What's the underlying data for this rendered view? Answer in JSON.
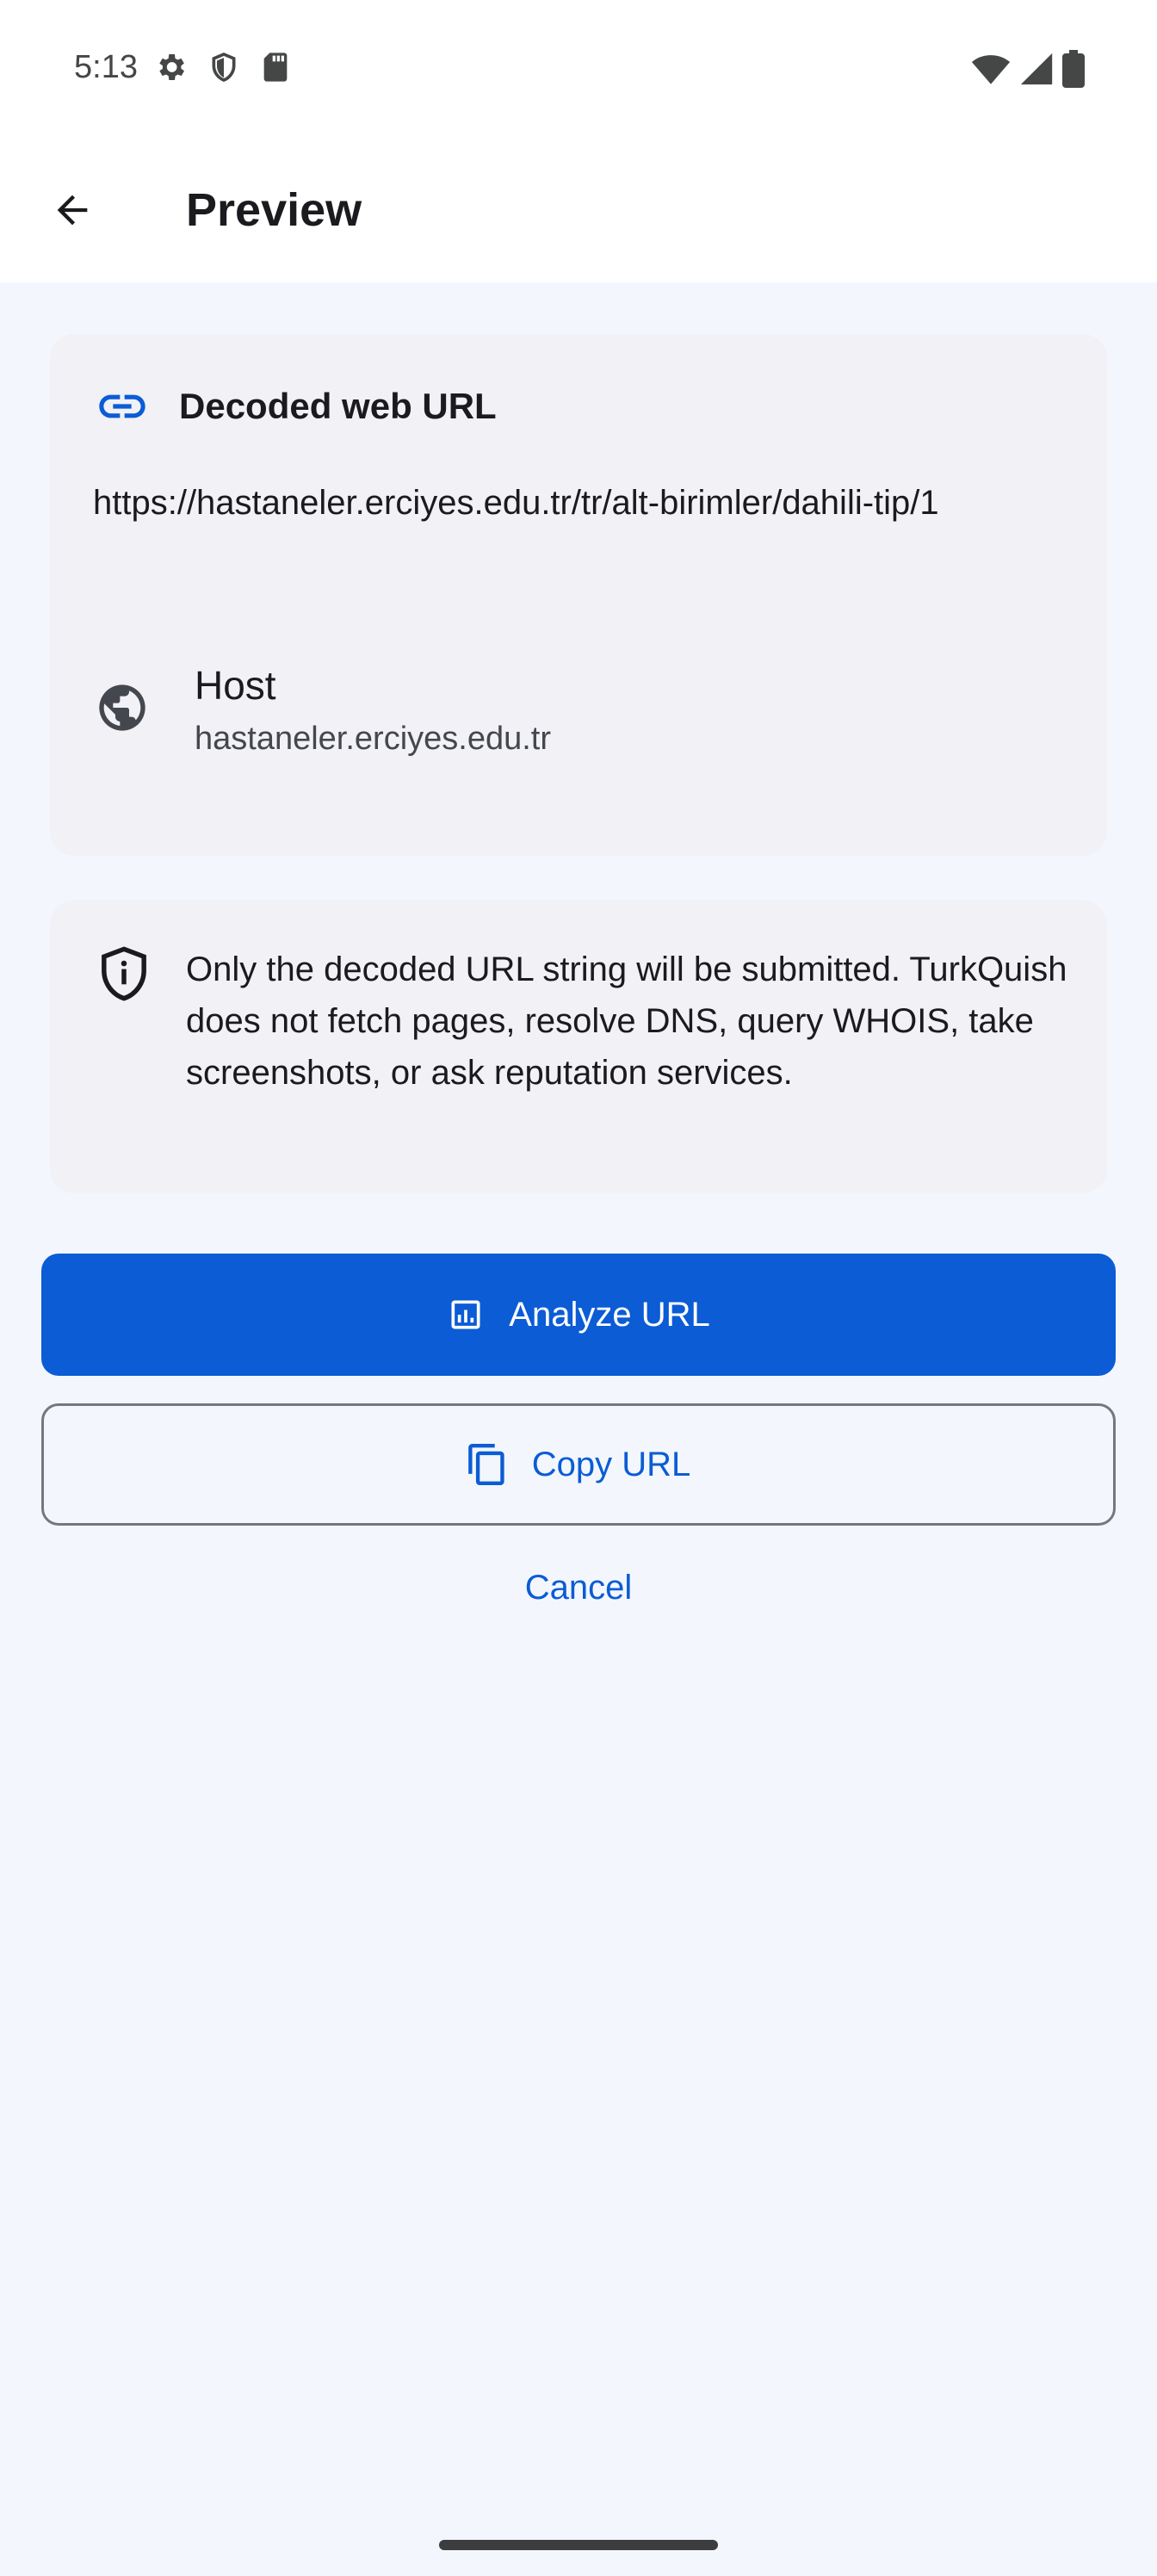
{
  "status_bar": {
    "time": "5:13",
    "icons_left": [
      "settings-icon",
      "shield-icon",
      "sd-card-icon"
    ],
    "icons_right": [
      "wifi-icon",
      "cell-signal-icon",
      "battery-icon"
    ]
  },
  "app_bar": {
    "title": "Preview",
    "back_icon": "arrow-back-icon"
  },
  "url_card": {
    "icon": "link-icon",
    "title": "Decoded web URL",
    "url": "https://hastaneler.erciyes.edu.tr/tr/alt-birimler/dahili-tip/1",
    "host_icon": "globe-icon",
    "host_label": "Host",
    "host_value": "hastaneler.erciyes.edu.tr"
  },
  "info_card": {
    "icon": "shield-info-icon",
    "text": "Only the decoded URL string will be submitted. TurkQuish does not fetch pages, resolve DNS, query WHOIS, take screenshots, or ask reputation services."
  },
  "actions": {
    "analyze_label": "Analyze URL",
    "analyze_icon": "analytics-icon",
    "copy_label": "Copy URL",
    "copy_icon": "copy-icon",
    "cancel_label": "Cancel"
  },
  "colors": {
    "accent": "#0B5CD5",
    "background": "#F3F7FD",
    "card": "#F1F1F6",
    "surface": "#FFFFFF"
  }
}
